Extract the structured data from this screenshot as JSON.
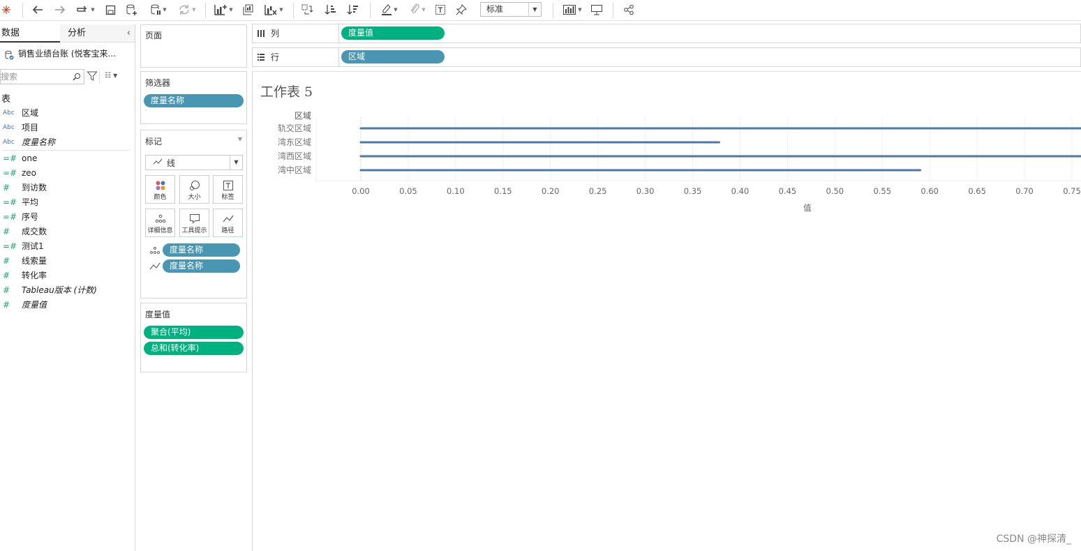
{
  "toolbar": {
    "view_size": "标准",
    "icons": [
      "tableau-logo-icon",
      "undo-icon",
      "redo-icon",
      "replay-icon",
      "save-icon",
      "new-datasource-icon",
      "datasource-paused-icon",
      "refresh-icon",
      "new-worksheet-icon",
      "duplicate-sheet-icon",
      "clear-sheet-icon",
      "swap-icon",
      "sort-ascending-icon",
      "sort-descending-icon",
      "highlight-icon",
      "group-icon",
      "label-icon",
      "pin-icon",
      "show-me-icon",
      "presentation-icon",
      "share-icon"
    ]
  },
  "left_pane": {
    "tabs": [
      "数据",
      "分析"
    ],
    "datasource": "销售业绩台账 (悦客宝来...",
    "search_placeholder": "搜索",
    "section_title": "表",
    "dimensions": [
      {
        "type": "Abc",
        "label": "区域",
        "italic": false
      },
      {
        "type": "Abc",
        "label": "项目",
        "italic": false
      },
      {
        "type": "Abc",
        "label": "度量名称",
        "italic": true
      }
    ],
    "measures": [
      {
        "type": "=#",
        "label": "one",
        "italic": false
      },
      {
        "type": "=#",
        "label": "zeo",
        "italic": false
      },
      {
        "type": "#",
        "label": "到访数",
        "italic": false
      },
      {
        "type": "=#",
        "label": "平均",
        "italic": false
      },
      {
        "type": "=#",
        "label": "序号",
        "italic": false
      },
      {
        "type": "#",
        "label": "成交数",
        "italic": false
      },
      {
        "type": "=#",
        "label": "测试1",
        "italic": false
      },
      {
        "type": "#",
        "label": "线索量",
        "italic": false
      },
      {
        "type": "#",
        "label": "转化率",
        "italic": false
      },
      {
        "type": "#",
        "label": "Tableau版本 (计数)",
        "italic": true
      },
      {
        "type": "#",
        "label": "度量值",
        "italic": true
      }
    ]
  },
  "shelves": {
    "pages_title": "页面",
    "filters_title": "筛选器",
    "filter_pill": "度量名称",
    "marks_title": "标记",
    "mark_type": "线",
    "mark_buttons": [
      "颜色",
      "大小",
      "标签",
      "详细信息",
      "工具提示",
      "路径"
    ],
    "mark_pills": [
      "度量名称",
      "度量名称"
    ],
    "measure_values_title": "度量值",
    "measure_values_pills": [
      "聚合(平均)",
      "总和(转化率)"
    ],
    "columns_label": "列",
    "columns_pill": "度量值",
    "rows_label": "行",
    "rows_pill": "区域"
  },
  "view": {
    "sheet_title": "工作表 5",
    "watermark": "CSDN @神探清_"
  },
  "chart_data": {
    "type": "bar",
    "row_header": "区域",
    "categories": [
      "轨交区域",
      "湾东区域",
      "湾西区域",
      "湾中区域"
    ],
    "values": [
      0.78,
      0.378,
      0.78,
      0.59
    ],
    "xlabel": "值",
    "x_ticks": [
      "0.00",
      "0.05",
      "0.10",
      "0.15",
      "0.20",
      "0.25",
      "0.30",
      "0.35",
      "0.40",
      "0.45",
      "0.50",
      "0.55",
      "0.60",
      "0.65",
      "0.70",
      "0.75"
    ],
    "xlim": [
      0,
      0.75
    ],
    "grid": true,
    "color": "#4e79a7"
  }
}
